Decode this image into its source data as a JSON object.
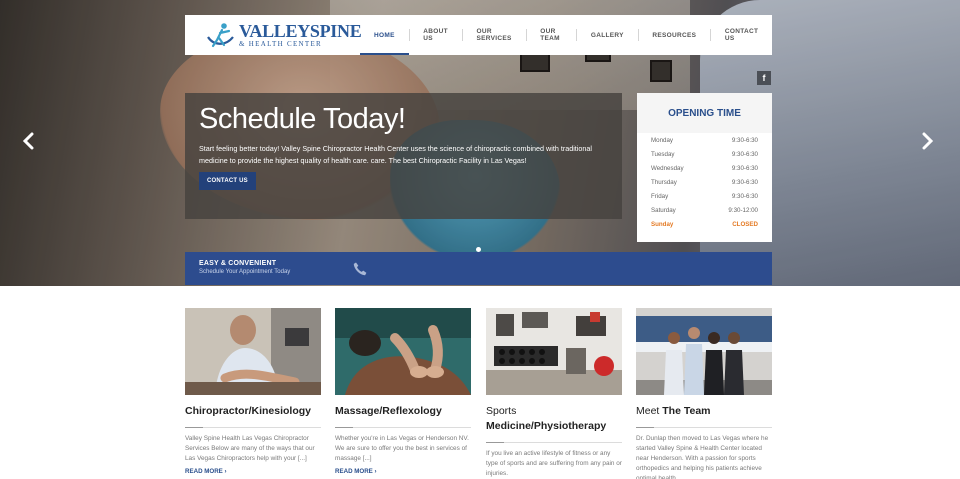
{
  "logo": {
    "title": "VALLEYSPINE",
    "subtitle": "& HEALTH CENTER"
  },
  "nav": [
    "HOME",
    "ABOUT US",
    "OUR SERVICES",
    "OUR TEAM",
    "GALLERY",
    "RESOURCES",
    "CONTACT US"
  ],
  "social": {
    "facebook": "f"
  },
  "slide": {
    "title": "Schedule Today!",
    "text": "Start feeling better today! Valley Spine Chiropractor Health Center uses the science of chiropractic combined with traditional medicine to provide the highest quality of health care. care. The best Chiropractic Facility in Las Vegas!",
    "button": "CONTACT US"
  },
  "hours": {
    "title": "OPENING TIME",
    "rows": [
      {
        "day": "Monday",
        "time": "9:30-6:30"
      },
      {
        "day": "Tuesday",
        "time": "9:30-6:30"
      },
      {
        "day": "Wednesday",
        "time": "9:30-6:30"
      },
      {
        "day": "Thursday",
        "time": "9:30-6:30"
      },
      {
        "day": "Friday",
        "time": "9:30-6:30"
      },
      {
        "day": "Saturday",
        "time": "9:30-12:00"
      },
      {
        "day": "Sunday",
        "time": "CLOSED"
      }
    ]
  },
  "easy": {
    "title": "EASY & CONVENIENT",
    "subtitle": "Schedule Your Appointment Today"
  },
  "cards": [
    {
      "title_plain": "",
      "title_bold": "Chiropractor/Kinesiology",
      "desc": "Valley Spine Health Las Vegas Chiropractor Services Below are many of the ways that our Las Vegas Chiropractors help with your [...]",
      "more": "READ MORE ›"
    },
    {
      "title_plain": "",
      "title_bold": "Massage/Reflexology",
      "desc": "Whether you're in Las Vegas or Henderson NV. We are sure to offer you the best in services of massage [...]",
      "more": "READ MORE ›"
    },
    {
      "title_plain": "Sports",
      "title_bold": "Medicine/Physiotherapy",
      "desc": "If you live an active lifestyle of fitness or any type of sports and are suffering from any pain or injuries.",
      "more": ""
    },
    {
      "title_plain": "Meet",
      "title_bold": "The Team",
      "desc": "Dr. Dunlap then moved to Las Vegas where he started Valley Spine & Health Center located near Henderson. With a passion for sports orthopedics and helping his patients achieve optimal health.",
      "more": ""
    }
  ],
  "colors": {
    "brand": "#2a4f8c",
    "bar": "#2d4c8e",
    "accent": "#e47a24"
  }
}
